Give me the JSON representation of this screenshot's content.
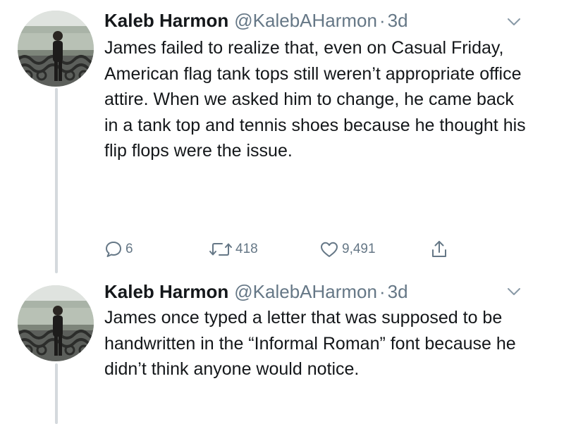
{
  "colors": {
    "text": "#14171a",
    "secondary": "#657786",
    "thread_line": "#d4d9dd"
  },
  "icons": {
    "reply": "speech-bubble-icon",
    "retweet": "retweet-arrows-icon",
    "like": "heart-outline-icon",
    "share": "share-upload-icon",
    "menu": "chevron-down-icon"
  },
  "tweets": [
    {
      "author": {
        "display_name": "Kaleb Harmon",
        "handle": "@KalebAHarmon",
        "separator": "·",
        "timestamp": "3d"
      },
      "text": "James failed to realize that, even on Casual Friday, American flag tank tops still weren’t appropriate office attire. When we asked him to change, he came back in a tank top and tennis shoes because he thought his flip flops were the issue.",
      "counts": {
        "replies": "6",
        "retweets": "418",
        "likes": "9,491"
      }
    },
    {
      "author": {
        "display_name": "Kaleb Harmon",
        "handle": "@KalebAHarmon",
        "separator": "·",
        "timestamp": "3d"
      },
      "text": "James once typed a letter that was supposed to be handwritten in the “Informal Roman” font because he didn’t think anyone would notice."
    }
  ]
}
